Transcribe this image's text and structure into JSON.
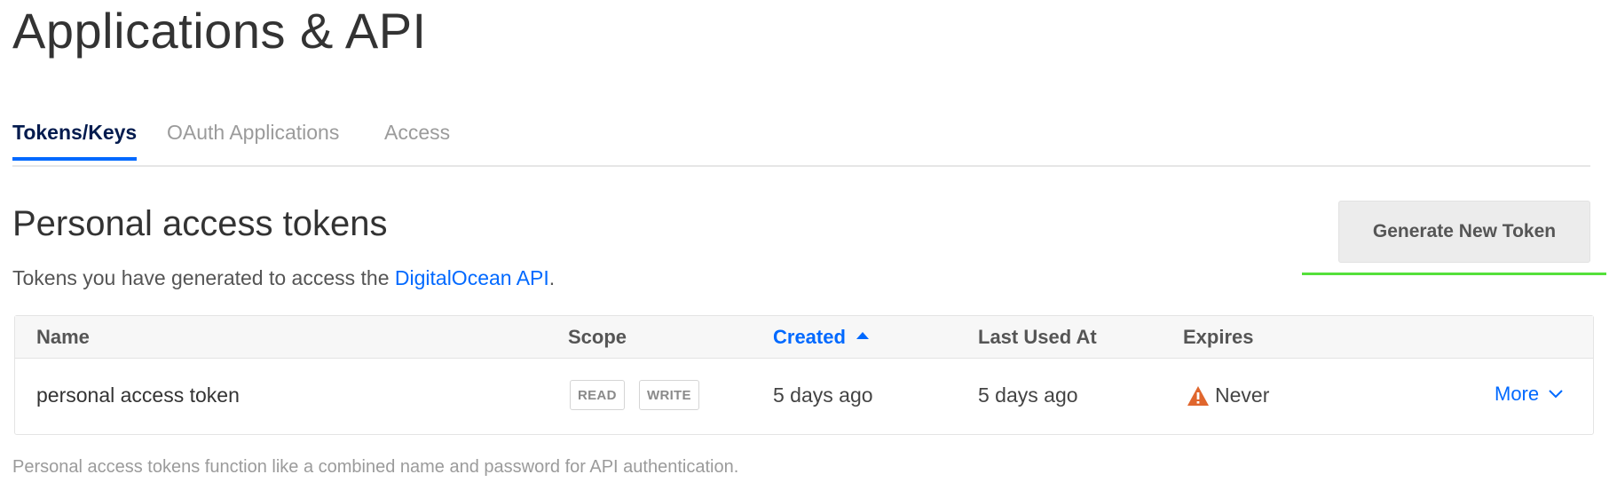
{
  "page": {
    "title": "Applications & API"
  },
  "tabs": [
    {
      "label": "Tokens/Keys",
      "active": true
    },
    {
      "label": "OAuth Applications",
      "active": false
    },
    {
      "label": "Access",
      "active": false
    }
  ],
  "section": {
    "title": "Personal access tokens",
    "subtitle_prefix": "Tokens you have generated to access the ",
    "subtitle_link": "DigitalOcean API",
    "subtitle_suffix": ".",
    "generate_button": "Generate New Token"
  },
  "table": {
    "columns": {
      "name": "Name",
      "scope": "Scope",
      "created": "Created",
      "last_used": "Last Used At",
      "expires": "Expires"
    },
    "sorted_column": "Created",
    "rows": [
      {
        "name": "personal access token",
        "scopes": [
          "READ",
          "WRITE"
        ],
        "created": "5 days ago",
        "last_used": "5 days ago",
        "expires": "Never",
        "more_label": "More"
      }
    ]
  },
  "footnote": "Personal access tokens function like a combined name and password for API authentication.",
  "colors": {
    "accent": "#0069ff",
    "warning": "#e0662d",
    "highlight": "#54e03a",
    "active_tab": "#031b4e"
  },
  "icons": {
    "sort": "caret-up-icon",
    "warning": "warning-triangle-icon",
    "more": "chevron-down-icon"
  }
}
